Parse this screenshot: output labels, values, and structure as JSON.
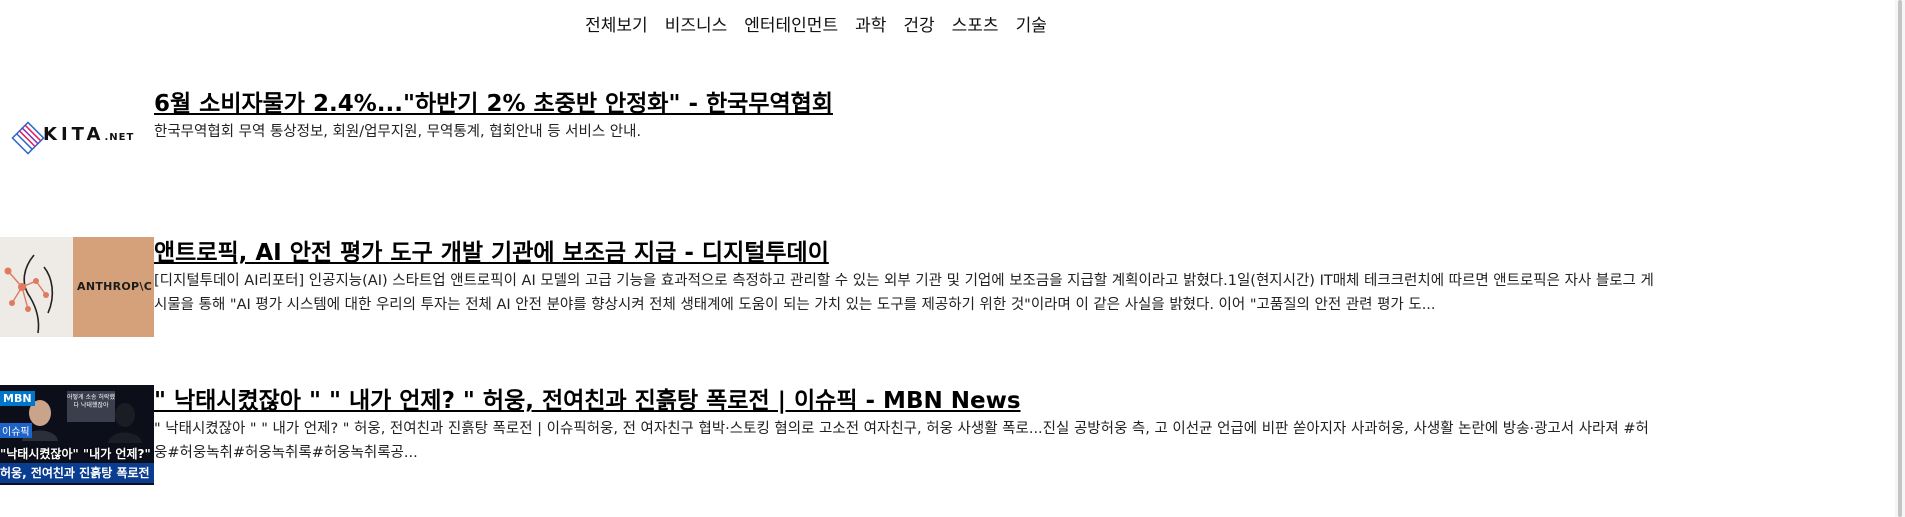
{
  "nav": {
    "items": [
      {
        "label": "전체보기"
      },
      {
        "label": "비즈니스"
      },
      {
        "label": "엔터테인먼트"
      },
      {
        "label": "과학"
      },
      {
        "label": "건강"
      },
      {
        "label": "스포츠"
      },
      {
        "label": "기술"
      }
    ]
  },
  "articles": [
    {
      "title": "6월 소비자물가 2.4%...\"하반기 2% 초중반 안정화\" - 한국무역협회",
      "description_lines": [
        "한국무역협회 무역 통상정보, 회원/업무지원, 무역통계, 협회안내 등 서비스 안내."
      ],
      "thumbnail": {
        "kind": "logo",
        "logo_text": "KITA",
        "logo_suffix": ".NET",
        "colors": [
          "#e6195a",
          "#2d66c7",
          "#7b2fb0"
        ]
      }
    },
    {
      "title": "앤트로픽, AI 안전 평가 도구 개발 기관에 보조금 지급 - 디지털투데이",
      "description_lines": [
        "[디지털투데이 AI리포터] 인공지능(AI) 스타트업 앤트로픽이 AI 모델의 고급 기능을 효과적으로 측정하고 관리할 수 있는 외부 기관 및 기업에 보조금을 지급할 계획이라고 밝혔다.1일(현지시간) IT매체 테크크런치에 따르면 앤트로픽은 자사 블로그 게",
        "시물을 통해 \"AI 평가 시스템에 대한 우리의 투자는 전체 AI 안전 분야를 향상시켜 전체 생태계에 도움이 되는 가치 있는 도구를 제공하기 위한 것\"이라며 이 같은 사실을 밝혔다. 이어 \"고품질의 안전 관련 평가 도..."
      ],
      "thumbnail": {
        "kind": "illustration",
        "brand_text": "ANTHROP\\C",
        "colors": {
          "left": "#eeeae5",
          "right": "#d4a17a",
          "nodes": "#e07a5f"
        }
      }
    },
    {
      "title": "\" 낙태시켰잖아 \"   \" 내가 언제? \"  허웅, 전여친과 진흙탕 폭로전 | 이슈픽 - MBN News",
      "description_lines": [
        "\" 낙태시켰잖아 \"   \" 내가 언제? \"  허웅, 전여친과 진흙탕 폭로전 | 이슈픽허웅, 전 여자친구 협박·스토킹 혐의로 고소전 여자친구, 허웅 사생활 폭로...진실 공방허웅 측, 고 이선균 언급에 비판 쏟아지자 사과허웅, 사생활 논란에 방송·광고서 사라져 #허",
        "웅#허웅녹취#허웅녹취록#허웅녹취록공..."
      ],
      "thumbnail": {
        "kind": "video-still",
        "logo_text": "MBN",
        "inner_text": "어떻게 소송 허락했다 낙태했잖아",
        "name_tag": "이슈픽",
        "caption_top": "\"낙태시켰잖아\" \"내가 언제?\"",
        "caption_bottom": "허웅, 전여친과 진흙탕 폭로전",
        "colors": {
          "bg": "#0c0f1a",
          "caption": "#0a3d8f",
          "tag": "#1e63c7"
        }
      }
    }
  ]
}
